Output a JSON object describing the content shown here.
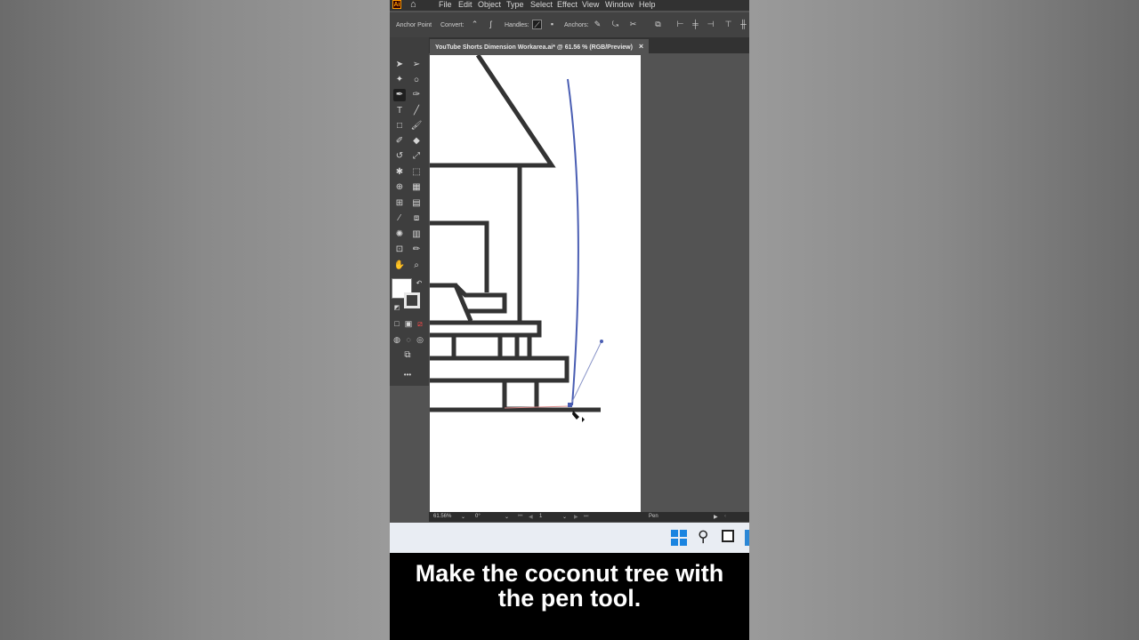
{
  "app": {
    "logo": "Ai"
  },
  "menu": [
    "File",
    "Edit",
    "Object",
    "Type",
    "Select",
    "Effect",
    "View",
    "Window",
    "Help"
  ],
  "control_bar": {
    "tool_name": "Anchor Point",
    "convert_label": "Convert:",
    "handles_label": "Handles:",
    "anchors_label": "Anchors:"
  },
  "document_tab": {
    "title": "YouTube Shorts Dimension Workarea.ai* @ 61.56 % (RGB/Preview)",
    "close": "×"
  },
  "status_bar": {
    "zoom": "61.56%",
    "rotation": "0°",
    "artboard_number": "1",
    "current_tool": "Pen"
  },
  "toolbar": {
    "more_tools": "•••"
  },
  "caption": {
    "line1": "Make the coconut tree with",
    "line2": "the pen tool."
  },
  "colors": {
    "ui_dark": "#323232",
    "ui_panel": "#424242",
    "canvas_bg": "#535353",
    "artboard": "#ffffff",
    "drawing_stroke": "#333333",
    "path_selection": "#4a5eb3",
    "taskbar": "#e9edf3",
    "windows_blue": "#1a84e0"
  }
}
